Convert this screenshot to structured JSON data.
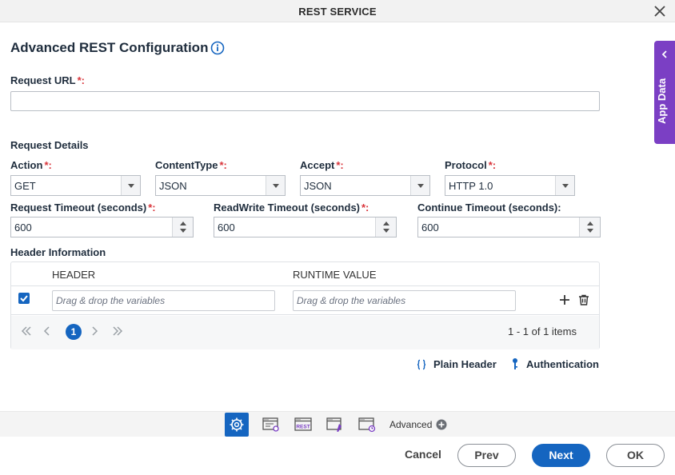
{
  "window": {
    "title": "REST SERVICE"
  },
  "page": {
    "heading": "Advanced REST Configuration"
  },
  "request_url": {
    "label": "Request URL",
    "required_mark": "*:",
    "value": ""
  },
  "request_details": {
    "section_label": "Request Details",
    "action": {
      "label": "Action",
      "required_mark": "*:",
      "value": "GET"
    },
    "content_type": {
      "label": "ContentType",
      "required_mark": "*:",
      "value": "JSON"
    },
    "accept": {
      "label": "Accept",
      "required_mark": "*:",
      "value": "JSON"
    },
    "protocol": {
      "label": "Protocol",
      "required_mark": "*:",
      "value": "HTTP 1.0"
    },
    "request_timeout": {
      "label": "Request Timeout (seconds)",
      "required_mark": "*:",
      "value": "600"
    },
    "readwrite_timeout": {
      "label": "ReadWrite Timeout (seconds)",
      "required_mark": "*:",
      "value": "600"
    },
    "continue_timeout": {
      "label": "Continue Timeout (seconds):",
      "value": "600"
    }
  },
  "header_information": {
    "section_label": "Header Information",
    "columns": [
      "HEADER",
      "RUNTIME VALUE"
    ],
    "rows": [
      {
        "checked": true,
        "header_placeholder": "Drag & drop the variables",
        "runtime_placeholder": "Drag & drop the variables"
      }
    ],
    "pager": {
      "current_page": "1",
      "items_text": "1 - 1 of 1 items"
    }
  },
  "links": {
    "plain_header": "Plain Header",
    "authentication": "Authentication"
  },
  "side_tab": {
    "label": "App Data"
  },
  "toolbar": {
    "tools": [
      "gear-icon",
      "window-link-icon",
      "rest-icon",
      "window-edit-icon",
      "window-clock-icon"
    ],
    "rest_badge": "REST",
    "advanced_label": "Advanced"
  },
  "footer": {
    "cancel": "Cancel",
    "prev": "Prev",
    "next": "Next",
    "ok": "OK"
  },
  "colors": {
    "primary": "#1565c0",
    "side_tab": "#7b3fc4",
    "required": "#d9343a"
  }
}
